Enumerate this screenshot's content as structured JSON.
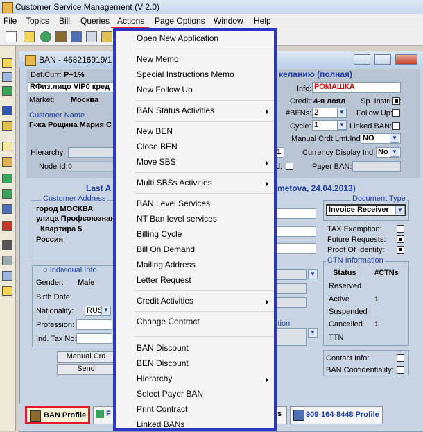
{
  "app": {
    "title": "Customer Service Management  (V 2.0)"
  },
  "menubar": {
    "items": [
      "File",
      "Topics",
      "Bill",
      "Queries",
      "Actions",
      "Page Options",
      "Window",
      "Help"
    ]
  },
  "ban_window": {
    "title": "BAN - 468216919/1 ,"
  },
  "header": {
    "def_curr_label": "Def.Curr:",
    "def_curr_value": "P+1%",
    "segment_value": "RФиз.лицо  VIP0  кред",
    "market_label": "Market:",
    "market_value": "Москва",
    "customer_name_label": "Customer Name",
    "customer_name_value": "Г-жа Рощина Мария С",
    "hierarchy_label": "Hierarchy:",
    "node_id_label": "Node Id:",
    "node_id_value": "0",
    "right_title": "келанию (полная)",
    "info_label": "Info:",
    "info_value": "РОМАШКА",
    "credit_label": "Credit:",
    "credit_value": "4-я лоял",
    "sp_instruct_label": "Sp. Instruct:",
    "bens_label": "#BENs:",
    "bens_value": "2",
    "follow_up_label": "Follow Up:",
    "cycle_label": "Cycle:",
    "cycle_value": "1",
    "linked_ban_label": "Linked BAN:",
    "manual_crdt_label": "Manual Crdt.Lmt.Ind:",
    "manual_crdt_value": "NO",
    "cycle2_value": "1",
    "currency_display_label": "Currency Display Ind:",
    "currency_display_value": "No",
    "d_label": "d:",
    "payer_ban_label": "Payer BAN:"
  },
  "lower": {
    "last_label": "Last A",
    "agent_text": "metova, 24.04.2013)",
    "customer_address_title": "Customer Address",
    "address_lines": [
      "город МОСКВА",
      "улица Профсоюзная",
      "  Квартира 5",
      "Россия"
    ],
    "document_type_title": "Document Type",
    "document_type_value": "Invoice Receiver",
    "tax_exemption_label": "TAX Exemption:",
    "future_requests_label": "Future Requests:",
    "proof_identity_label": "Proof Of Identity:",
    "individual_info_label": "Individual Info",
    "gender_label": "Gender:",
    "gender_value": "Male",
    "birth_date_label": "Birth Date:",
    "nationality_label": "Nationality:",
    "nationality_value": "RUS",
    "profession_label": "Profession:",
    "ind_tax_label": "Ind. Tax No:",
    "ition_label": "ition",
    "manual_crd_button": "Manual Crd",
    "send_button": "Send",
    "ctn_title": "CTN Information",
    "ctn_status_header": "Status",
    "ctn_count_header": "#CTNs",
    "ctn_rows": [
      {
        "status": "Reserved",
        "count": ""
      },
      {
        "status": "Active",
        "count": "1"
      },
      {
        "status": "Suspended",
        "count": ""
      },
      {
        "status": "Cancelled",
        "count": "1"
      },
      {
        "status": "TTN",
        "count": ""
      }
    ],
    "contact_info_label": "Contact Info:",
    "ban_confidentiality_label": "BAN Confidentiality:"
  },
  "actions_menu": {
    "items": [
      {
        "label": "Open New Application",
        "submenu": false
      },
      {
        "label": "New Memo",
        "submenu": false
      },
      {
        "label": "Special Instructions Memo",
        "submenu": false
      },
      {
        "label": "New Follow Up",
        "submenu": false
      },
      {
        "label": "BAN Status Activities",
        "submenu": true
      },
      {
        "label": "New BEN",
        "submenu": false
      },
      {
        "label": "Close BEN",
        "submenu": false
      },
      {
        "label": "Move SBS",
        "submenu": true
      },
      {
        "label": "Multi SBSs Activities",
        "submenu": true
      },
      {
        "label": "BAN Level Services",
        "submenu": false
      },
      {
        "label": "NT Ban level services",
        "submenu": false
      },
      {
        "label": "Billing Cycle",
        "submenu": false
      },
      {
        "label": "Bill On Demand",
        "submenu": false
      },
      {
        "label": "Mailing Address",
        "submenu": false
      },
      {
        "label": "Letter Request",
        "submenu": false
      },
      {
        "label": "Credit Activities",
        "submenu": true
      },
      {
        "label": "Change Contract",
        "submenu": false
      },
      {
        "label": "BAN Discount",
        "submenu": false
      },
      {
        "label": "BEN Discount",
        "submenu": false
      },
      {
        "label": "Hierarchy",
        "submenu": true
      },
      {
        "label": "Select Payer BAN",
        "submenu": false
      },
      {
        "label": "Print Contract",
        "submenu": false
      },
      {
        "label": "Linked BANs",
        "submenu": false
      }
    ]
  },
  "tabs": {
    "ban_profile": "BAN Profile",
    "f_tab": "F",
    "s_tab": "s",
    "ctn_profile": "909-164-8448 Profile"
  },
  "colors": {
    "highlight_red": "#e0182a",
    "menu_border_blue": "#2b35c8",
    "label_blue": "#1b3fa6"
  }
}
